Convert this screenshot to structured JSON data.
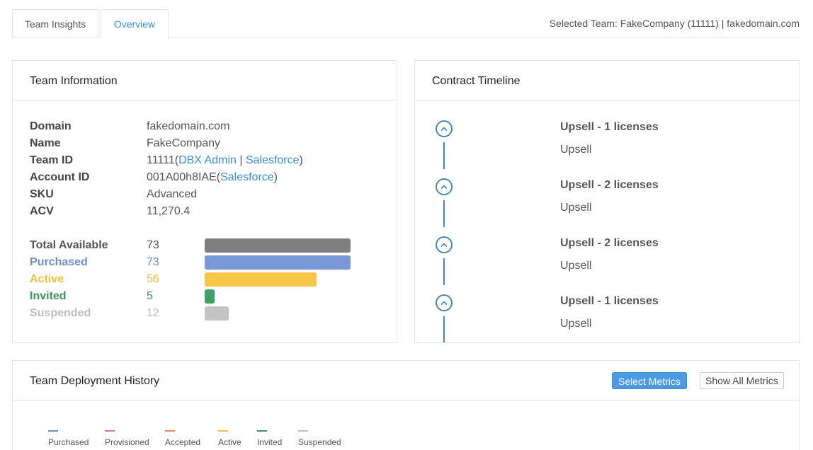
{
  "tabs": [
    {
      "label": "Team Insights",
      "active": false
    },
    {
      "label": "Overview",
      "active": true
    }
  ],
  "selected_team": "Selected Team: FakeCompany (11111) | fakedomain.com",
  "team_info": {
    "title": "Team Information",
    "domain_label": "Domain",
    "domain_value": "fakedomain.com",
    "name_label": "Name",
    "name_value": "FakeCompany",
    "team_id_label": "Team ID",
    "team_id_value": "11111",
    "team_id_open": "(",
    "team_id_link1": "DBX Admin",
    "team_id_sep": " | ",
    "team_id_link2": "Salesforce",
    "team_id_close": ")",
    "account_id_label": "Account ID",
    "account_id_value": "001A00h8IAE",
    "account_id_open": "(",
    "account_id_link": "Salesforce",
    "account_id_close": ")",
    "sku_label": "SKU",
    "sku_value": "Advanced",
    "acv_label": "ACV",
    "acv_value": "11,270.4",
    "licenses": [
      {
        "label": "Total Available",
        "value": "73",
        "fraction": 1.0,
        "color": "#7f7f7f",
        "label_color": "#555555"
      },
      {
        "label": "Purchased",
        "value": "73",
        "fraction": 1.0,
        "color": "#7b98d6",
        "label_color": "#6f8fc7"
      },
      {
        "label": "Active",
        "value": "56",
        "fraction": 0.767,
        "color": "#f8c74a",
        "label_color": "#f2c040"
      },
      {
        "label": "Invited",
        "value": "5",
        "fraction": 0.068,
        "color": "#3fa068",
        "label_color": "#3e9264"
      },
      {
        "label": "Suspended",
        "value": "12",
        "fraction": 0.164,
        "color": "#c4c4c4",
        "label_color": "#bdbdbd"
      }
    ]
  },
  "contract": {
    "title": "Contract Timeline",
    "items": [
      {
        "title": "Upsell - 1 licenses",
        "type": "Upsell"
      },
      {
        "title": "Upsell - 2 licenses",
        "type": "Upsell"
      },
      {
        "title": "Upsell - 2 licenses",
        "type": "Upsell"
      },
      {
        "title": "Upsell - 1 licenses",
        "type": "Upsell"
      }
    ]
  },
  "history": {
    "title": "Team Deployment History",
    "select_metrics": "Select Metrics",
    "show_all": "Show All Metrics",
    "legend": [
      {
        "label": "Purchased",
        "color": "#6f8fc7"
      },
      {
        "label": "Provisioned",
        "color": "#c77bb5"
      },
      {
        "label": "Accepted",
        "color": "#ef8a5a"
      },
      {
        "label": "Active",
        "color": "#f2c040"
      },
      {
        "label": "Invited",
        "color": "#3e9264"
      },
      {
        "label": "Suspended",
        "color": "#bdbdbd"
      }
    ]
  }
}
